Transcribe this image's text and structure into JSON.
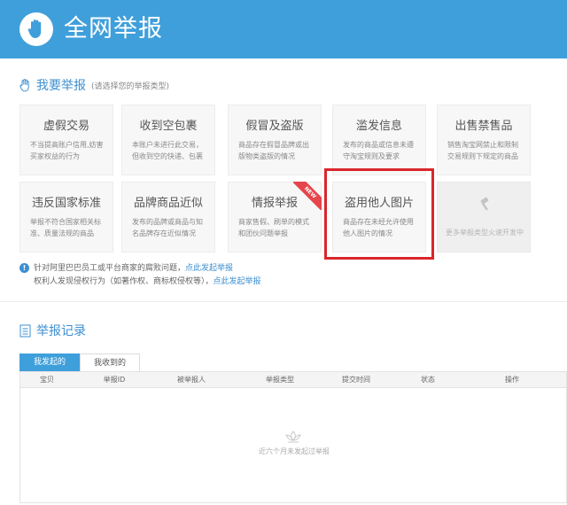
{
  "header": {
    "title": "全网举报",
    "logo_icon": "hand-shield-icon"
  },
  "report_section": {
    "title": "我要举报",
    "hint": "(请选择您的举报类型)",
    "cards": [
      {
        "title": "虚假交易",
        "desc": "不当提高账户信用,妨害买家权益的行为"
      },
      {
        "title": "收到空包裹",
        "desc": "本账户未进行此交易，但收到空的快递、包裹"
      },
      {
        "title": "假冒及盗版",
        "desc": "商品存在假冒品牌或出版物类盗版的情况"
      },
      {
        "title": "滥发信息",
        "desc": "发布的商品或信息未遵守淘宝规则及要求"
      },
      {
        "title": "出售禁售品",
        "desc": "销售淘宝网禁止和限制交易规则下规定的商品"
      },
      {
        "title": "违反国家标准",
        "desc": "举报不符合国家相关标准、质量法规的商品"
      },
      {
        "title": "品牌商品近似",
        "desc": "发布的品牌或商品与知名品牌存在近似情况"
      },
      {
        "title": "情报举报",
        "desc": "商家售假、刷单的模式和团伙问题举报",
        "badge": "NEW"
      },
      {
        "title": "盗用他人图片",
        "desc": "商品存在未经允许使用他人图片的情况"
      }
    ],
    "disabled_card": {
      "desc": "更多举报类型火速开发中",
      "icon": "gavel-icon"
    }
  },
  "notice": {
    "line1_text": "针对阿里巴巴员工或平台商家的腐败问题，",
    "line1_link": "点此发起举报",
    "line2_text": "权利人发现侵权行为（如著作权、商标权侵权等），",
    "line2_link": "点此发起举报"
  },
  "records_section": {
    "title": "举报记录",
    "tabs": [
      "我发起的",
      "我收到的"
    ],
    "columns": [
      "宝贝",
      "举报ID",
      "被举报人",
      "举报类型",
      "提交时间",
      "状态",
      "操作"
    ],
    "empty_text": "近六个月未发起过举报"
  },
  "colors": {
    "brand": "#3f9fdb",
    "highlight": "#d9262c",
    "badge": "#e5454b"
  }
}
